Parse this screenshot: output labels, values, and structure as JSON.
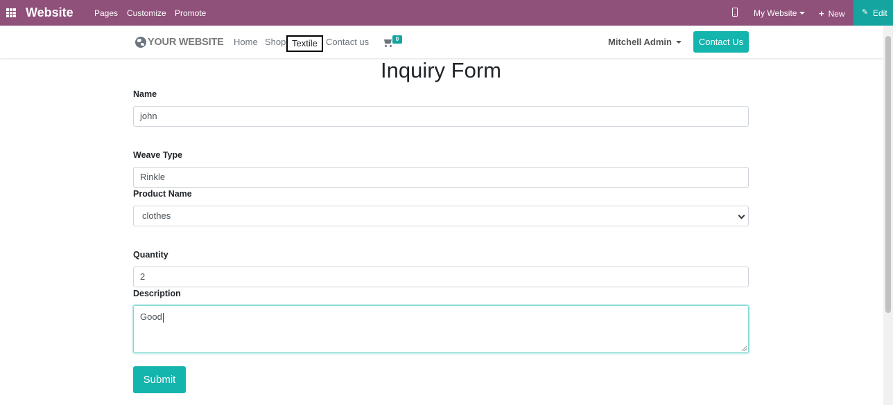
{
  "topbar": {
    "brand": "Website",
    "menu": [
      "Pages",
      "Customize",
      "Promote"
    ],
    "website_selector": "My Website",
    "new_label": "New",
    "edit_label": "Edit",
    "color": "#8f507a",
    "edit_color": "#14a5a0"
  },
  "navbar": {
    "logo_text": "YOUR WEBSITE",
    "links": [
      "Home",
      "Shop",
      "Textile",
      "Contact us"
    ],
    "active_link": "Textile",
    "cart_count": "0",
    "user": "Mitchell Admin",
    "contact_button": "Contact Us",
    "accent": "#14b5ad"
  },
  "form": {
    "title": "Inquiry Form",
    "name": {
      "label": "Name",
      "value": "john"
    },
    "weave_type": {
      "label": "Weave Type",
      "value": "Rinkle"
    },
    "product_name": {
      "label": "Product Name",
      "value": "clothes"
    },
    "quantity": {
      "label": "Quantity",
      "value": "2"
    },
    "description": {
      "label": "Description",
      "value": "Good"
    },
    "submit_label": "Submit"
  },
  "icons": [
    "apps-icon",
    "mobile-icon",
    "plus-icon",
    "pencil-icon",
    "globe-icon",
    "cart-icon",
    "caret-down-icon"
  ]
}
